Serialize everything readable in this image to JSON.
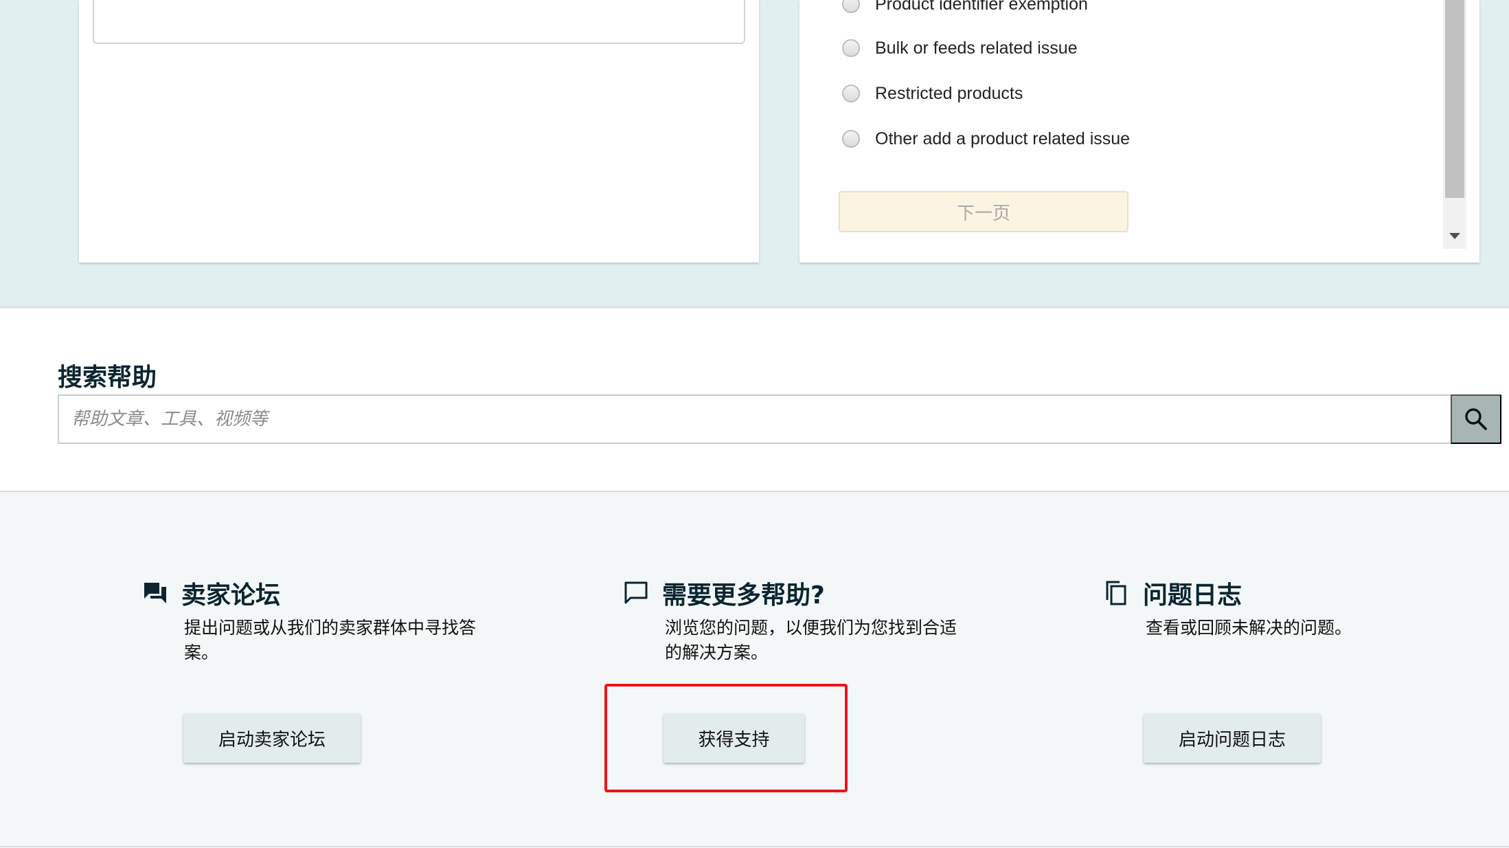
{
  "issue_options": [
    {
      "label": "Product identifier exemption"
    },
    {
      "label": "Bulk or feeds related issue"
    },
    {
      "label": "Restricted products"
    },
    {
      "label": "Other add a product related issue"
    }
  ],
  "next_button": {
    "label": "下一页"
  },
  "search": {
    "title": "搜索帮助",
    "placeholder": "帮助文章、工具、视频等"
  },
  "help_cards": [
    {
      "icon": "forum-chat-icon",
      "title": "卖家论坛",
      "description": "提出问题或从我们的卖家群体中寻找答案。",
      "button": "启动卖家论坛"
    },
    {
      "icon": "speech-bubble-icon",
      "title": "需要更多帮助?",
      "description": "浏览您的问题，以便我们为您找到合适的解决方案。",
      "button": "获得支持"
    },
    {
      "icon": "copy-pages-icon",
      "title": "问题日志",
      "description": "查看或回顾未解决的问题。",
      "button": "启动问题日志"
    }
  ],
  "colors": {
    "teal_band": "#e2eff0",
    "heading": "#0b2530",
    "button_bg": "#e3ecec",
    "highlight": "#e8151a"
  }
}
